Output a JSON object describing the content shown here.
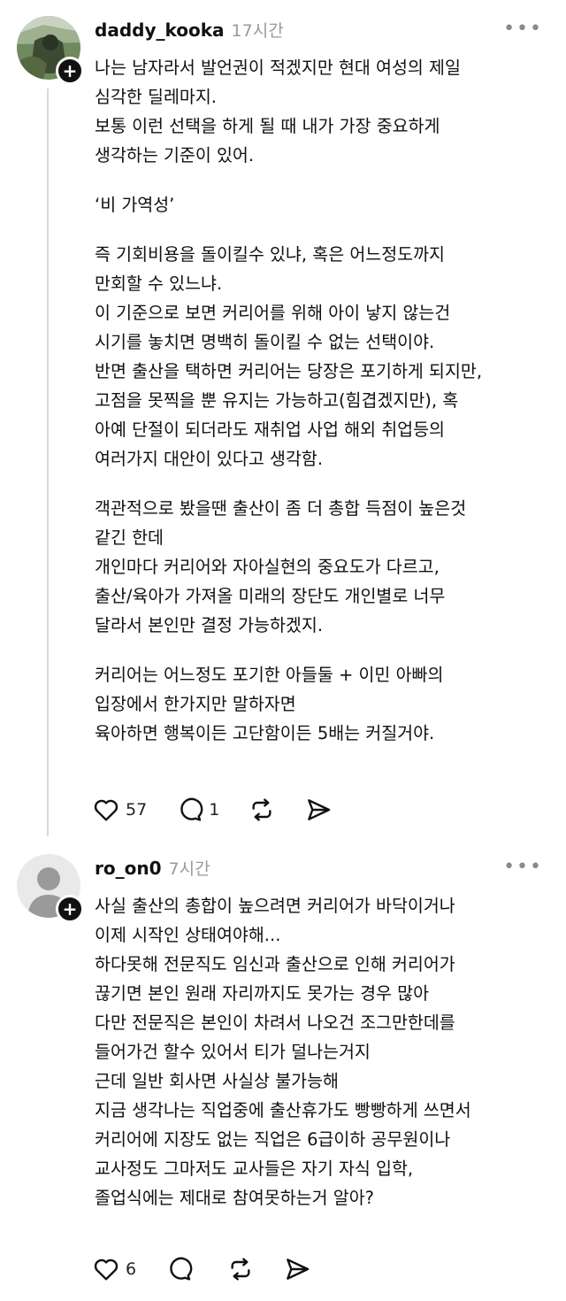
{
  "comments": [
    {
      "username": "daddy_kooka",
      "time": "17시간",
      "more_label": "•••",
      "avatar_icon": "profile-photo",
      "follow_icon": "plus-icon",
      "paragraphs": [
        [
          "나는 남자라서 발언권이 적겠지만 현대 여성의 제일",
          "심각한 딜레마지.",
          "보통 이런 선택을 하게 될 때 내가 가장 중요하게",
          "생각하는 기준이 있어."
        ],
        [
          "‘비 가역성’"
        ],
        [
          "즉 기회비용을 돌이킬수 있냐, 혹은 어느정도까지",
          "만회할 수 있느냐.",
          "이 기준으로 보면 커리어를 위해 아이 낳지 않는건",
          "시기를 놓치면 명백히 돌이킬 수 없는 선택이야.",
          "반면 출산을 택하면 커리어는 당장은 포기하게 되지만,",
          "고점을 못찍을 뿐 유지는 가능하고(힘겹겠지만), 혹",
          "아예 단절이 되더라도 재취업 사업 해외 취업등의",
          "여러가지 대안이 있다고 생각함."
        ],
        [
          "객관적으로 봤을땐 출산이 좀 더 총합 득점이 높은것",
          "같긴 한데",
          "개인마다 커리어와 자아실현의 중요도가 다르고,",
          "출산/육아가 가져올 미래의 장단도 개인별로 너무",
          "달라서 본인만 결정 가능하겠지."
        ],
        [
          "커리어는 어느정도 포기한 아들둘 + 이민 아빠의",
          "입장에서 한가지만 말하자면",
          "육아하면 행복이든 고단함이든 5배는 커질거야."
        ]
      ],
      "likes": "57",
      "replies": "1"
    },
    {
      "username": "ro_on0",
      "time": "7시간",
      "more_label": "•••",
      "avatar_icon": "default-avatar",
      "follow_icon": "plus-icon",
      "paragraphs": [
        [
          "사실 출산의 총합이 높으려면 커리어가 바닥이거나",
          "이제 시작인 상태여야해...",
          "하다못해 전문직도 임신과 출산으로 인해 커리어가",
          "끊기면 본인 원래 자리까지도 못가는 경우 많아",
          "다만 전문직은 본인이 차려서 나오건 조그만한데를",
          "들어가건 할수 있어서 티가 덜나는거지",
          "근데 일반 회사면 사실상 불가능해",
          "지금 생각나는 직업중에 출산휴가도 빵빵하게 쓰면서",
          "커리어에 지장도 없는 직업은 6급이하 공무원이나",
          "교사정도 그마저도 교사들은 자기 자식 입학,",
          "졸업식에는 제대로 참여못하는거 알아?"
        ]
      ],
      "likes": "6",
      "replies": ""
    }
  ]
}
